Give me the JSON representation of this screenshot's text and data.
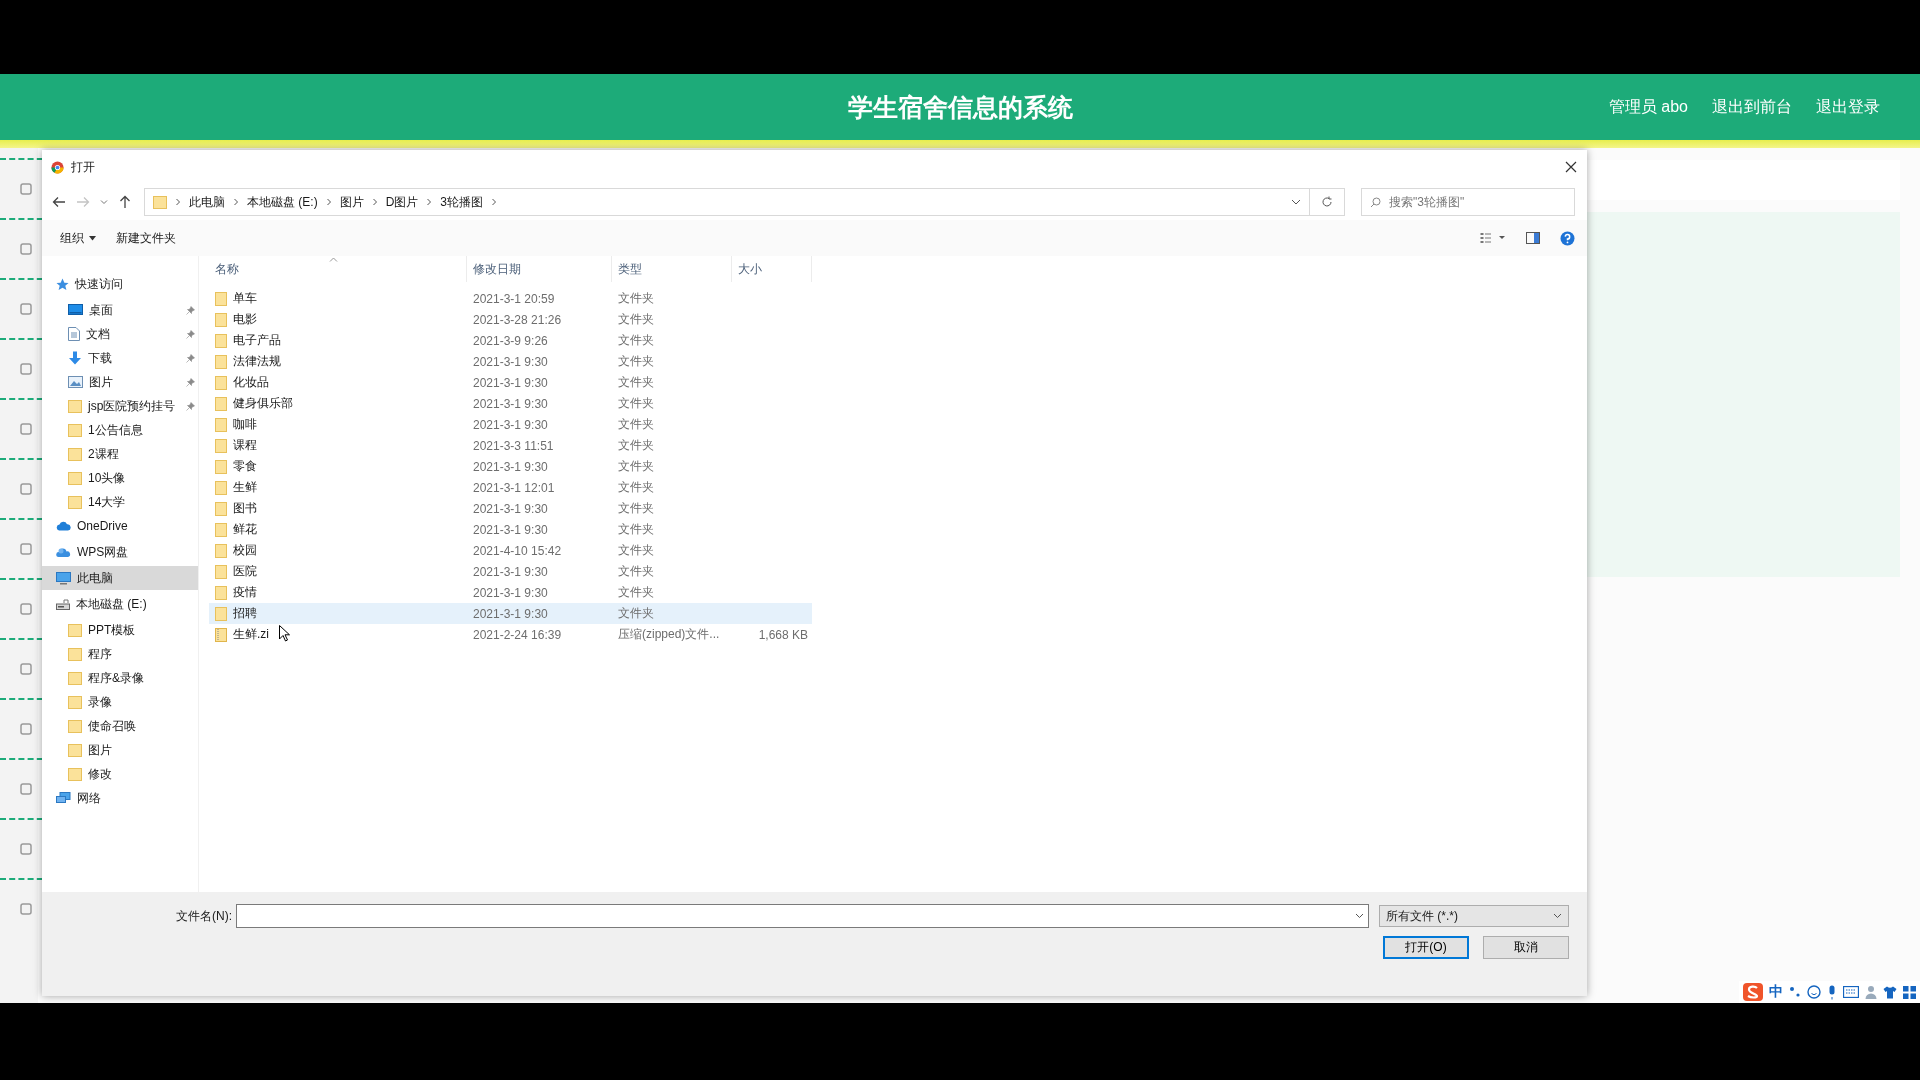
{
  "header": {
    "title": "学生宿舍信息的系统",
    "links": [
      "管理员 abo",
      "退出到前台",
      "退出登录"
    ]
  },
  "dialog": {
    "title": "打开",
    "address": [
      "此电脑",
      "本地磁盘 (E:)",
      "图片",
      "D图片",
      "3轮播图"
    ],
    "search": {
      "placeholder": "搜索\"3轮播图\""
    },
    "toolbar": [
      "组织",
      "新建文件夹"
    ],
    "nav": [
      {
        "label": "快速访问",
        "kind": "star",
        "selected": false,
        "children": [
          {
            "label": "桌面",
            "kind": "desktop",
            "pinned": true,
            "selected": false
          },
          {
            "label": "文档",
            "kind": "document",
            "pinned": true,
            "selected": false
          },
          {
            "label": "下载",
            "kind": "download",
            "pinned": true,
            "selected": false
          },
          {
            "label": "图片",
            "kind": "image",
            "pinned": true,
            "selected": false
          },
          {
            "label": "jsp医院预约挂号",
            "kind": "folder",
            "pinned": true,
            "selected": false
          },
          {
            "label": "1公告信息",
            "kind": "folder",
            "pinned": false,
            "selected": false
          },
          {
            "label": "2课程",
            "kind": "folder",
            "pinned": false,
            "selected": false
          },
          {
            "label": "10头像",
            "kind": "folder",
            "pinned": false,
            "selected": false
          },
          {
            "label": "14大学",
            "kind": "folder",
            "pinned": false,
            "selected": false
          }
        ]
      },
      {
        "label": "OneDrive",
        "kind": "cloud",
        "selected": false
      },
      {
        "label": "WPS网盘",
        "kind": "cloud2",
        "selected": false
      },
      {
        "label": "此电脑",
        "kind": "computer",
        "selected": true
      },
      {
        "label": "本地磁盘 (E:)",
        "kind": "drive",
        "selected": false,
        "children": [
          {
            "label": "PPT模板",
            "kind": "folder",
            "selected": false
          },
          {
            "label": "程序",
            "kind": "folder",
            "selected": false
          },
          {
            "label": "程序&录像",
            "kind": "folder",
            "selected": false
          },
          {
            "label": "录像",
            "kind": "folder",
            "selected": false
          },
          {
            "label": "使命召唤",
            "kind": "folder",
            "selected": false
          },
          {
            "label": "图片",
            "kind": "folder",
            "selected": false
          },
          {
            "label": "修改",
            "kind": "folder",
            "selected": false
          }
        ]
      },
      {
        "label": "网络",
        "kind": "network",
        "selected": false
      }
    ],
    "columns": [
      "名称",
      "修改日期",
      "类型",
      "大小"
    ],
    "rows": [
      {
        "name": "单车",
        "date": "2021-3-1 20:59",
        "type": "文件夹",
        "kind": "folder",
        "selected": false
      },
      {
        "name": "电影",
        "date": "2021-3-28 21:26",
        "type": "文件夹",
        "kind": "folder",
        "selected": false
      },
      {
        "name": "电子产品",
        "date": "2021-3-9 9:26",
        "type": "文件夹",
        "kind": "folder",
        "selected": false
      },
      {
        "name": "法律法规",
        "date": "2021-3-1 9:30",
        "type": "文件夹",
        "kind": "folder",
        "selected": false
      },
      {
        "name": "化妆品",
        "date": "2021-3-1 9:30",
        "type": "文件夹",
        "kind": "folder",
        "selected": false
      },
      {
        "name": "健身俱乐部",
        "date": "2021-3-1 9:30",
        "type": "文件夹",
        "kind": "folder",
        "selected": false
      },
      {
        "name": "咖啡",
        "date": "2021-3-1 9:30",
        "type": "文件夹",
        "kind": "folder",
        "selected": false
      },
      {
        "name": "课程",
        "date": "2021-3-3 11:51",
        "type": "文件夹",
        "kind": "folder",
        "selected": false
      },
      {
        "name": "零食",
        "date": "2021-3-1 9:30",
        "type": "文件夹",
        "kind": "folder",
        "selected": false
      },
      {
        "name": "生鲜",
        "date": "2021-3-1 12:01",
        "type": "文件夹",
        "kind": "folder",
        "selected": false
      },
      {
        "name": "图书",
        "date": "2021-3-1 9:30",
        "type": "文件夹",
        "kind": "folder",
        "selected": false
      },
      {
        "name": "鲜花",
        "date": "2021-3-1 9:30",
        "type": "文件夹",
        "kind": "folder",
        "selected": false
      },
      {
        "name": "校园",
        "date": "2021-4-10 15:42",
        "type": "文件夹",
        "kind": "folder",
        "selected": false
      },
      {
        "name": "医院",
        "date": "2021-3-1 9:30",
        "type": "文件夹",
        "kind": "folder",
        "selected": false
      },
      {
        "name": "疫情",
        "date": "2021-3-1 9:30",
        "type": "文件夹",
        "kind": "folder",
        "selected": false
      },
      {
        "name": "招聘",
        "date": "2021-3-1 9:30",
        "type": "文件夹",
        "kind": "folder",
        "selected": true
      },
      {
        "name": "生鲜.zi",
        "date": "2021-2-24 16:39",
        "type": "压缩(zipped)文件...",
        "size": "1,668 KB",
        "kind": "zip",
        "selected": false
      }
    ],
    "filename_label": "文件名(N):",
    "filter": "所有文件 (*.*)",
    "buttons": [
      {
        "label": "打开(O)",
        "primary": true
      },
      {
        "label": "取消",
        "primary": false
      }
    ]
  },
  "tray": {
    "ime_label": "中"
  }
}
